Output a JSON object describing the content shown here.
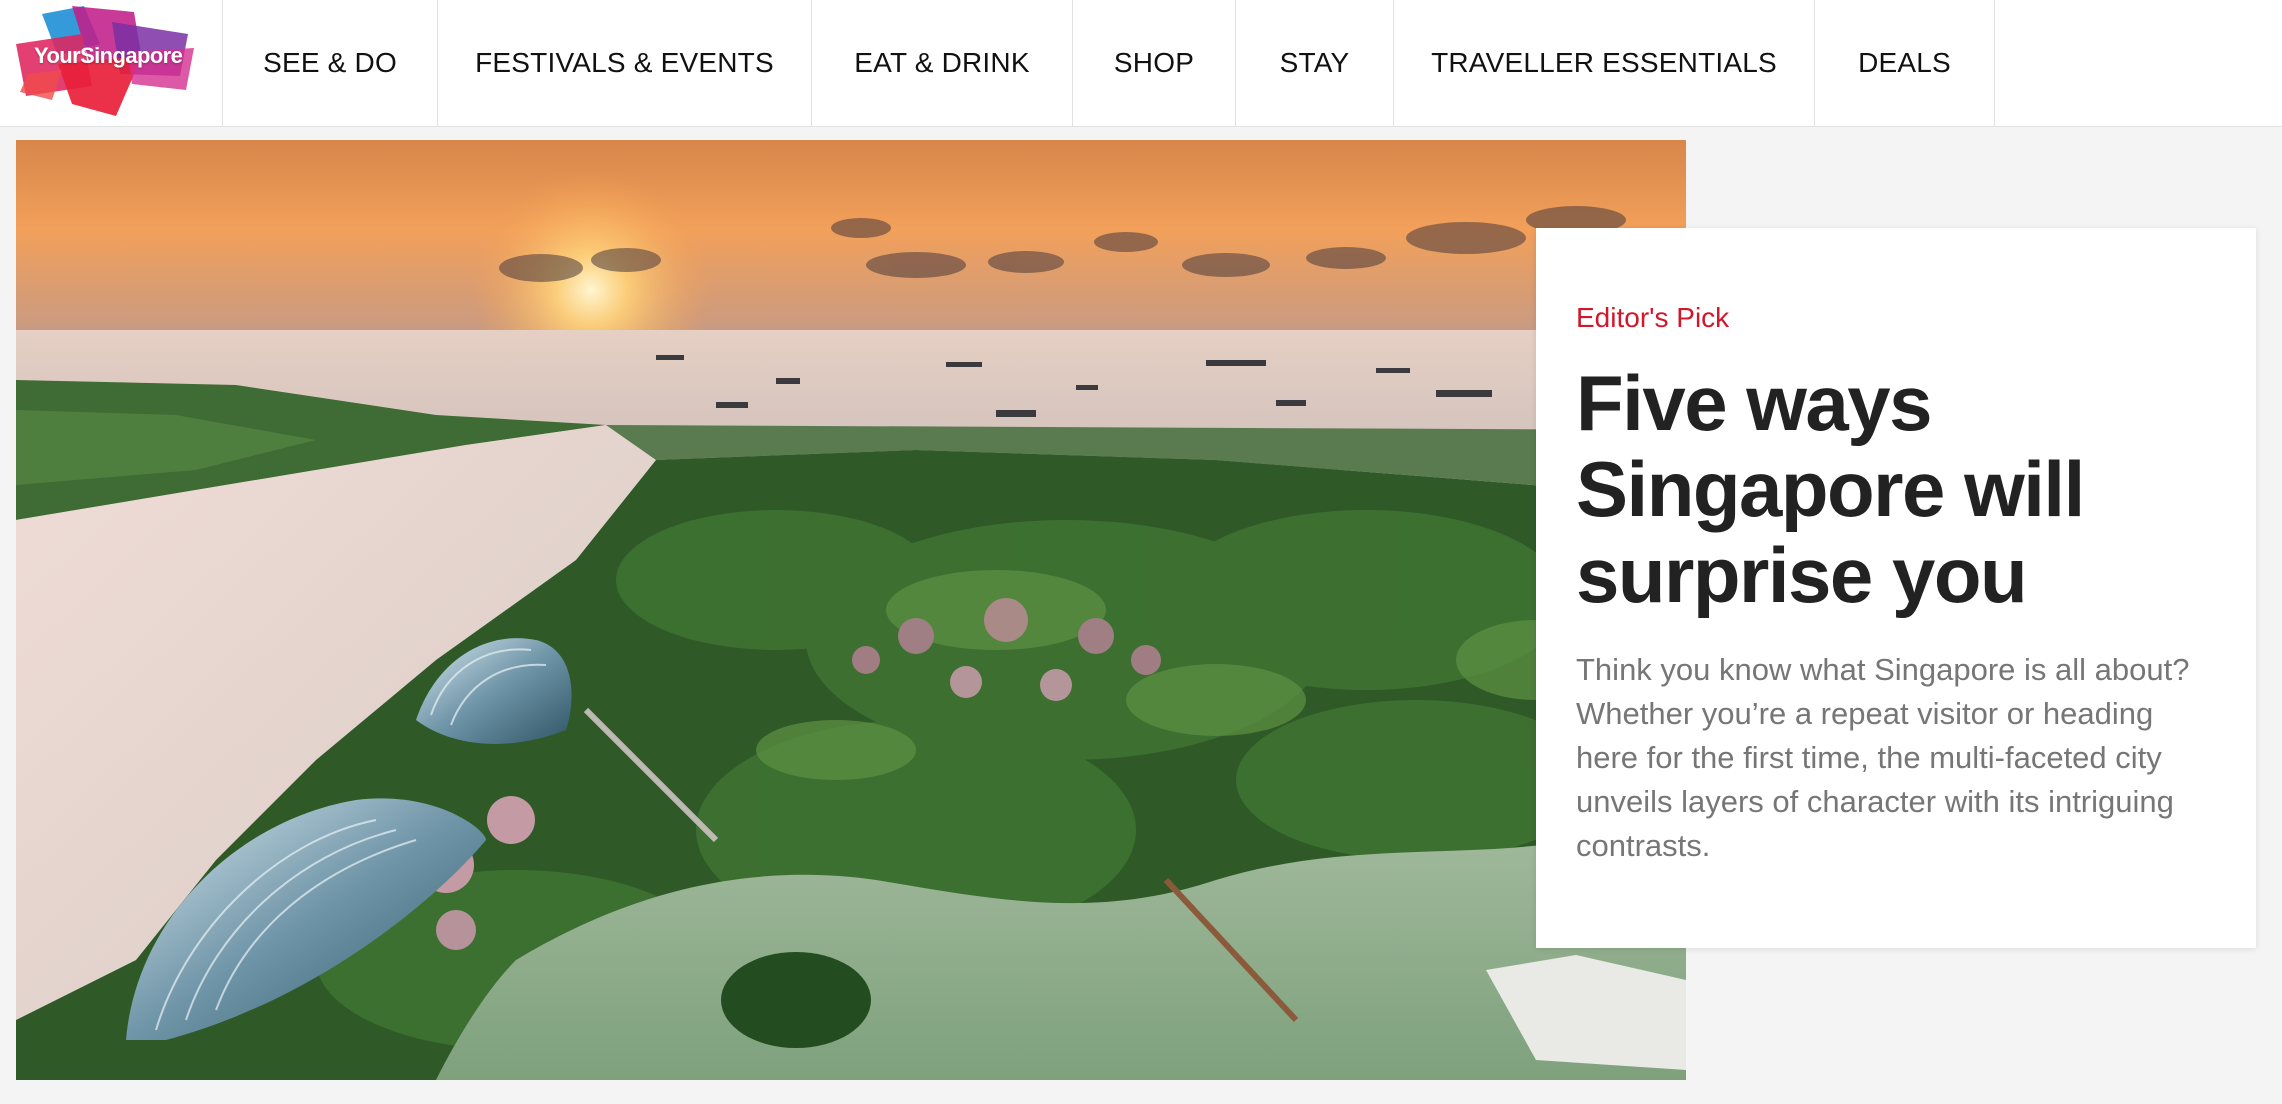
{
  "brand": {
    "name": "YourSingapore"
  },
  "nav": {
    "items": [
      {
        "label": "SEE & DO"
      },
      {
        "label": "FESTIVALS & EVENTS"
      },
      {
        "label": "EAT & DRINK"
      },
      {
        "label": "SHOP"
      },
      {
        "label": "STAY"
      },
      {
        "label": "TRAVELLER ESSENTIALS"
      },
      {
        "label": "DEALS"
      }
    ]
  },
  "feature": {
    "eyebrow": "Editor's Pick",
    "title": "Five ways Singapore will surprise you",
    "description": "Think you know what Singapore is all about? Whether you’re a repeat visitor or heading here for the first time, the multi-faceted city unveils layers of character with its intriguing contrasts."
  },
  "colors": {
    "accent": "#d0182c",
    "text": "#222222",
    "muted": "#767676",
    "background": "#f4f4f4"
  }
}
